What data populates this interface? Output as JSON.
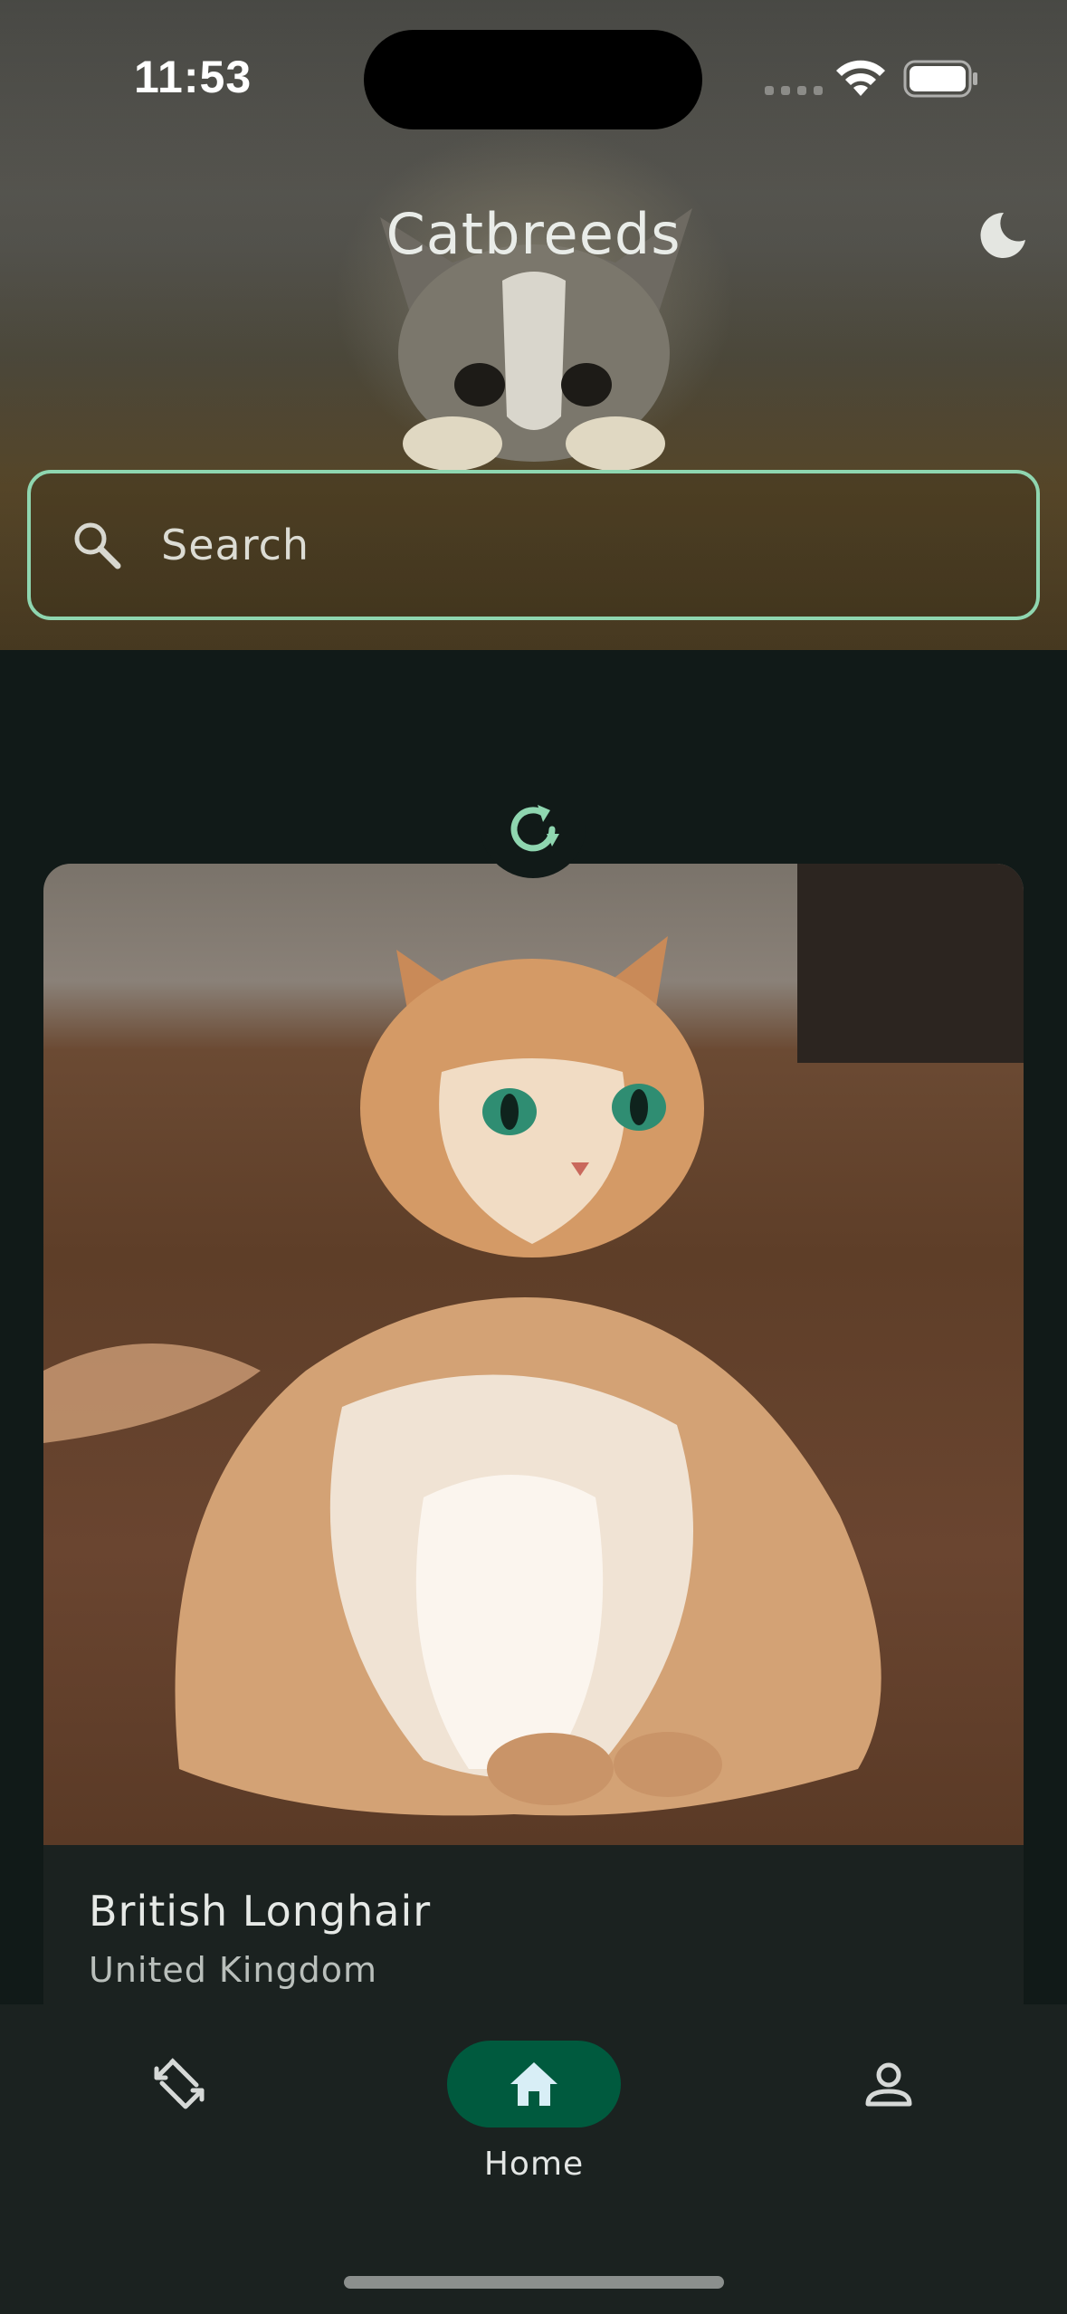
{
  "status_bar": {
    "time": "11:53"
  },
  "header": {
    "title": "Catbreeds",
    "theme_toggle_icon": "moon-icon"
  },
  "search": {
    "placeholder": "Search",
    "icon": "search-icon",
    "accent": "#8fd6b0"
  },
  "refresh": {
    "icon": "refresh-icon",
    "accent": "#8fd6b0"
  },
  "breed_card": {
    "name": "British Longhair",
    "origin": "United Kingdom"
  },
  "bottom_nav": {
    "items": [
      {
        "icon": "swap-icon",
        "label": "",
        "active": false
      },
      {
        "icon": "home-icon",
        "label": "Home",
        "active": true
      },
      {
        "icon": "profile-icon",
        "label": "",
        "active": false
      }
    ],
    "active_color": "#005a3e"
  },
  "colors": {
    "background": "#111a18",
    "surface": "#1b2220"
  }
}
